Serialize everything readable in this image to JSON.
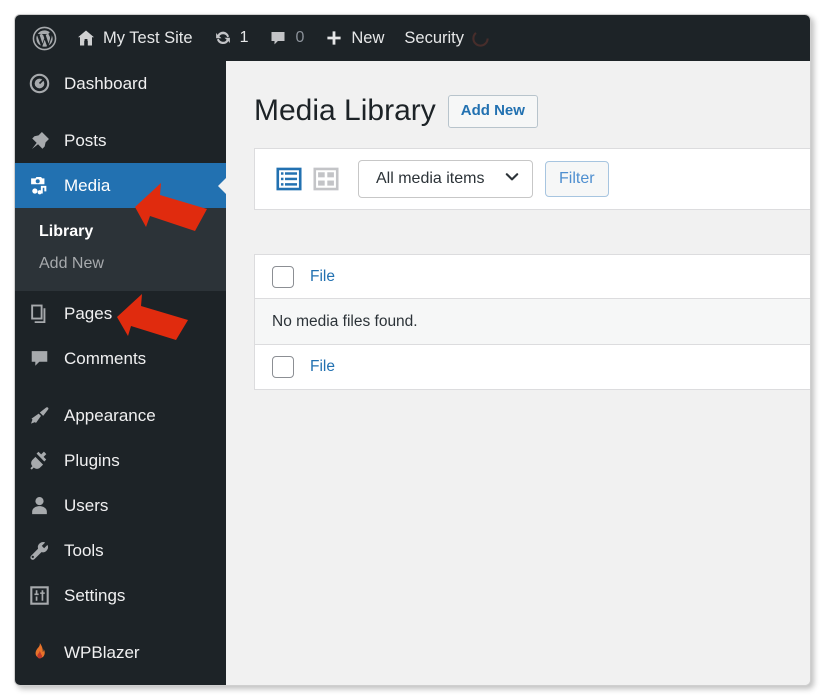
{
  "admin_bar": {
    "logo_icon": "wordpress-logo-icon",
    "site": {
      "icon": "home-icon",
      "label": "My Test Site"
    },
    "updates": {
      "icon": "updates-icon",
      "count": "1"
    },
    "comments": {
      "icon": "comment-bubble-icon",
      "count": "0"
    },
    "new": {
      "icon": "plus-icon",
      "label": "New"
    },
    "security": {
      "label": "Security",
      "icon": "loading-spinner-icon"
    }
  },
  "sidebar": {
    "items": [
      {
        "label": "Dashboard",
        "icon": "dashboard-icon",
        "current": false
      },
      {
        "label": "Posts",
        "icon": "pin-icon",
        "current": false
      },
      {
        "label": "Media",
        "icon": "media-camera-music-icon",
        "current": true
      },
      {
        "label": "Pages",
        "icon": "pages-icon",
        "current": false
      },
      {
        "label": "Comments",
        "icon": "comment-bubble-icon",
        "current": false
      },
      {
        "label": "Appearance",
        "icon": "paintbrush-icon",
        "current": false
      },
      {
        "label": "Plugins",
        "icon": "plug-icon",
        "current": false
      },
      {
        "label": "Users",
        "icon": "user-icon",
        "current": false
      },
      {
        "label": "Tools",
        "icon": "wrench-icon",
        "current": false
      },
      {
        "label": "Settings",
        "icon": "settings-sliders-icon",
        "current": false
      },
      {
        "label": "WPBlazer",
        "icon": "flame-icon",
        "current": false
      }
    ],
    "submenu": [
      {
        "label": "Library",
        "current": true
      },
      {
        "label": "Add New",
        "current": false
      }
    ]
  },
  "main": {
    "title": "Media Library",
    "add_new_label": "Add New",
    "toolbar": {
      "list_view_icon": "list-view-icon",
      "grid_view_icon": "grid-view-icon",
      "media_filter_value": "All media items",
      "media_filter_options": [
        "All media items"
      ],
      "dropdown_icon": "chevron-down-icon",
      "filter_label": "Filter"
    },
    "table": {
      "header_col_file": "File",
      "empty_message": "No media files found.",
      "footer_col_file": "File"
    }
  },
  "annotations": {
    "arrow_media": "red-arrow-pointing-to-media",
    "arrow_add_new": "red-arrow-pointing-to-add-new",
    "arrow_color": "#e02b0e"
  },
  "colors": {
    "admin_dark": "#1d2327",
    "submenu_dark": "#2c3338",
    "accent_blue": "#2271b1",
    "page_bg": "#f1f1f1"
  }
}
